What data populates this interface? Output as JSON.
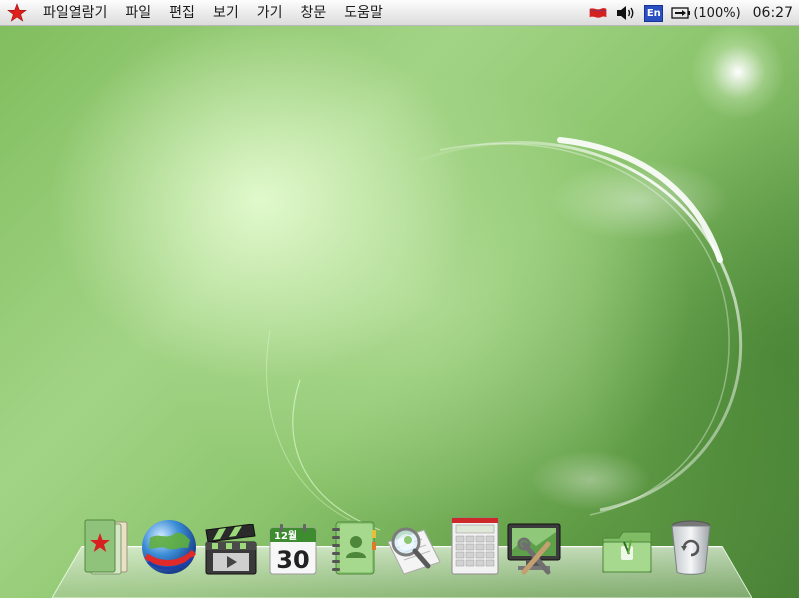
{
  "menubar": {
    "menus": [
      "파일열람기",
      "파일",
      "편집",
      "보기",
      "가기",
      "창문",
      "도움말"
    ],
    "battery_text": "(100%)",
    "language_indicator": "En",
    "clock": "06:27"
  },
  "dock": {
    "calendar_month": "12월",
    "calendar_day": "30"
  },
  "colors": {
    "star": "#e0201c",
    "flag": "#d42020",
    "en_badge": "#2a4fc0"
  },
  "icons": [
    "red-star-icon",
    "flag-icon",
    "volume-icon",
    "keyboard-language-icon",
    "battery-icon",
    "documents-icon",
    "browser-globe-icon",
    "video-player-icon",
    "calendar-icon",
    "address-book-icon",
    "search-magnifier-icon",
    "calculator-icon",
    "system-settings-icon",
    "file-manager-folder-icon",
    "trash-icon"
  ]
}
